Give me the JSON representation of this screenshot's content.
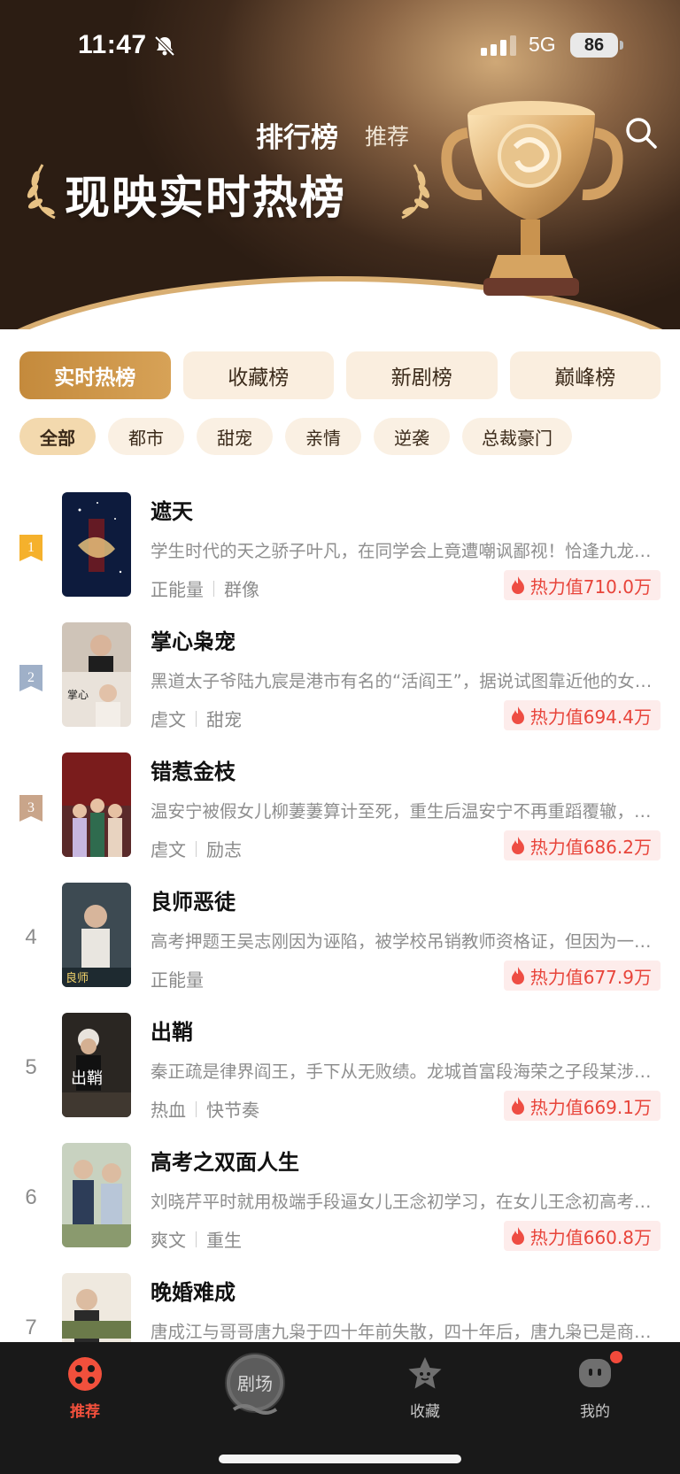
{
  "status_bar": {
    "time": "11:47",
    "network": "5G",
    "battery": "86"
  },
  "header": {
    "tab_main": "排行榜",
    "tab_sub": "推荐",
    "banner_title": "现映实时热榜",
    "search_icon": "search-icon"
  },
  "tabs": [
    {
      "label": "实时热榜",
      "active": true
    },
    {
      "label": "收藏榜",
      "active": false
    },
    {
      "label": "新剧榜",
      "active": false
    },
    {
      "label": "巅峰榜",
      "active": false
    }
  ],
  "chips": [
    {
      "label": "全部",
      "active": true
    },
    {
      "label": "都市",
      "active": false
    },
    {
      "label": "甜宠",
      "active": false
    },
    {
      "label": "亲情",
      "active": false
    },
    {
      "label": "逆袭",
      "active": false
    },
    {
      "label": "总裁豪门",
      "active": false
    }
  ],
  "list": [
    {
      "rank": "1",
      "title": "遮天",
      "desc": "学生时代的天之骄子叶凡，在同学会上竟遭嘲讽鄙视！恰逢九龙拉棺降临，叶凡的人生彻底改变",
      "tags": [
        "正能量",
        "群像"
      ],
      "heat": "热力值710.0万"
    },
    {
      "rank": "2",
      "title": "掌心枭宠",
      "desc": "黑道太子爷陆九宸是港市有名的“活阎王”，据说试图靠近他的女人都没有好下场",
      "tags": [
        "虐文",
        "甜宠"
      ],
      "heat": "热力值694.4万"
    },
    {
      "rank": "3",
      "title": "错惹金枝",
      "desc": "温安宁被假女儿柳萋萋算计至死，重生后温安宁不再重蹈覆辙，誓要夺回属于自己的一切",
      "tags": [
        "虐文",
        "励志"
      ],
      "heat": "热力值686.2万"
    },
    {
      "rank": "4",
      "title": "良师恶徒",
      "desc": "高考押题王吴志刚因为诬陷，被学校吊销教师资格证，但因为一次意外他重新站上讲台",
      "tags": [
        "正能量"
      ],
      "heat": "热力值677.9万"
    },
    {
      "rank": "5",
      "title": "出鞘",
      "desc": "秦正疏是律界阎王，手下从无败绩。龙城首富段海荣之子段某涉嫌一桩命案",
      "tags": [
        "热血",
        "快节奏"
      ],
      "heat": "热力值669.1万"
    },
    {
      "rank": "6",
      "title": "高考之双面人生",
      "desc": "刘晓芹平时就用极端手段逼女儿王念初学习，在女儿王念初高考前夕发生了意外",
      "tags": [
        "爽文",
        "重生"
      ],
      "heat": "热力值660.8万"
    },
    {
      "rank": "7",
      "title": "晚婚难成",
      "desc": "唐成江与哥哥唐九枭于四十年前失散，四十年后，唐九枭已是商界巨擘",
      "tags": [],
      "heat": ""
    }
  ],
  "bottom_nav": {
    "items": [
      {
        "label": "推荐",
        "icon": "recommend-icon",
        "active": true
      },
      {
        "label": "剧场",
        "icon": "theater-icon",
        "active": false
      },
      {
        "label": "收藏",
        "icon": "star-icon",
        "active": false
      },
      {
        "label": "我的",
        "icon": "profile-icon",
        "active": false
      }
    ]
  },
  "colors": {
    "accent_gold": "#c48a3c",
    "heat_red": "#e8443a",
    "nav_active": "#f2503c",
    "rank1": "#f5b12c",
    "rank2": "#9fb0c8",
    "rank3": "#c9a58a"
  }
}
